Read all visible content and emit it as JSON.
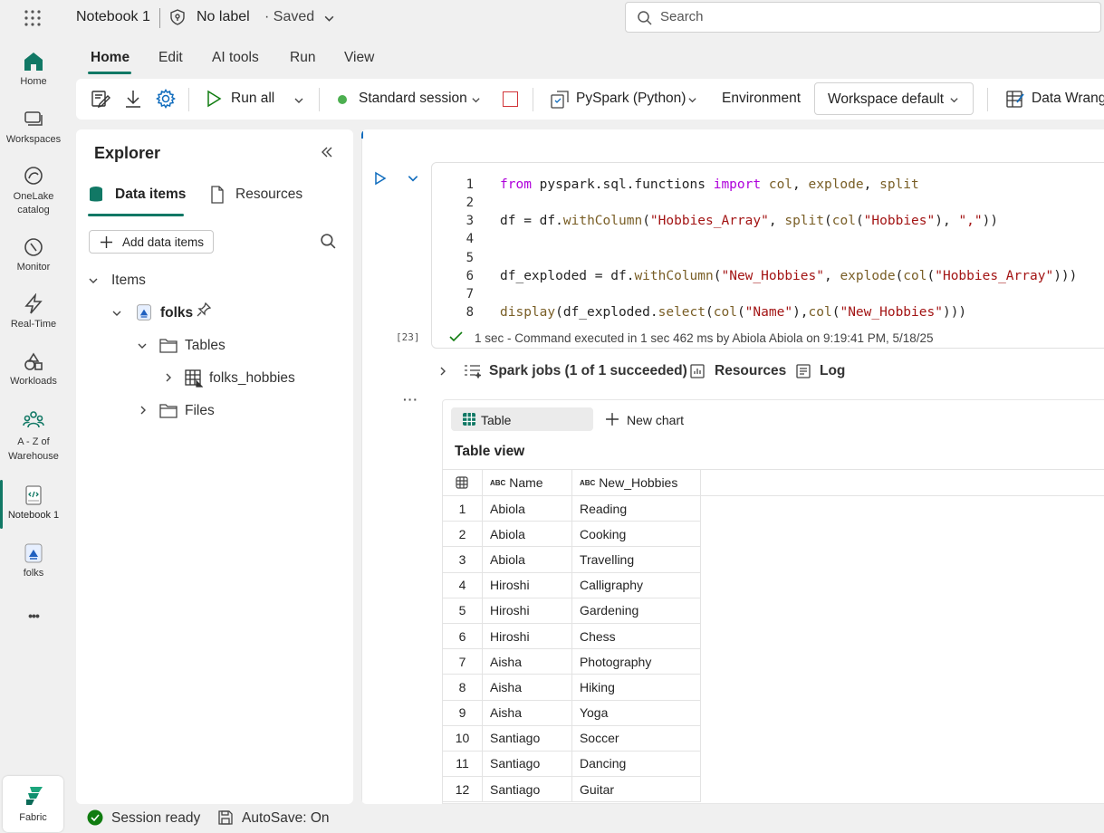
{
  "topbar": {
    "notebook_title": "Notebook 1",
    "label": "No label",
    "saved": "· Saved",
    "search_placeholder": "Search"
  },
  "rail": {
    "items": [
      {
        "label": "Home"
      },
      {
        "label": "Workspaces"
      },
      {
        "label_line1": "OneLake",
        "label_line2": "catalog"
      },
      {
        "label": "Monitor"
      },
      {
        "label": "Real-Time"
      },
      {
        "label": "Workloads"
      },
      {
        "label_line1": "A - Z of",
        "label_line2": "Warehouse"
      },
      {
        "label": "Notebook 1"
      },
      {
        "label": "folks"
      }
    ],
    "more": "•••",
    "fabric_label": "Fabric"
  },
  "tabs": [
    "Home",
    "Edit",
    "AI tools",
    "Run",
    "View"
  ],
  "toolbar": {
    "run_all": "Run all",
    "session": "Standard session",
    "language": "PySpark (Python)",
    "environment_label": "Environment",
    "environment_value": "Workspace default",
    "data_wrangler": "Data Wrangler"
  },
  "explorer": {
    "title": "Explorer",
    "tab_data_items": "Data items",
    "tab_resources": "Resources",
    "add_data_items": "Add data items",
    "tree": {
      "items": "Items",
      "lakehouse": "folks",
      "tables": "Tables",
      "table_name": "folks_hobbies",
      "files": "Files"
    }
  },
  "cell": {
    "exec_count": "[23]",
    "status_duration": "1 sec",
    "status_text": " - Command executed in 1 sec 462 ms by Abiola Abiola on 9:19:41 PM, 5/18/25",
    "spark_jobs": "Spark jobs (1 of 1 succeeded)",
    "resources": "Resources",
    "log": "Log",
    "line_numbers": [
      "1",
      "2",
      "3",
      "4",
      "5",
      "6",
      "7",
      "8"
    ]
  },
  "output": {
    "table_tab": "Table",
    "new_chart": "New chart",
    "table_view": "Table view",
    "columns": [
      "Name",
      "New_Hobbies"
    ],
    "type_badge": "ABC",
    "rows": [
      [
        "1",
        "Abiola",
        "Reading"
      ],
      [
        "2",
        "Abiola",
        "Cooking"
      ],
      [
        "3",
        "Abiola",
        "Travelling"
      ],
      [
        "4",
        "Hiroshi",
        "Calligraphy"
      ],
      [
        "5",
        "Hiroshi",
        "Gardening"
      ],
      [
        "6",
        "Hiroshi",
        "Chess"
      ],
      [
        "7",
        "Aisha",
        "Photography"
      ],
      [
        "8",
        "Aisha",
        "Hiking"
      ],
      [
        "9",
        "Aisha",
        "Yoga"
      ],
      [
        "10",
        "Santiago",
        "Soccer"
      ],
      [
        "11",
        "Santiago",
        "Dancing"
      ],
      [
        "12",
        "Santiago",
        "Guitar"
      ]
    ]
  },
  "statusbar": {
    "session_ready": "Session ready",
    "autosave": "AutoSave: On"
  },
  "colors": {
    "accent": "#117865",
    "run_green": "#107c10",
    "code_keyword": "#af00db",
    "code_function": "#795e26",
    "code_string": "#a31515",
    "stop_red": "#d13438"
  }
}
